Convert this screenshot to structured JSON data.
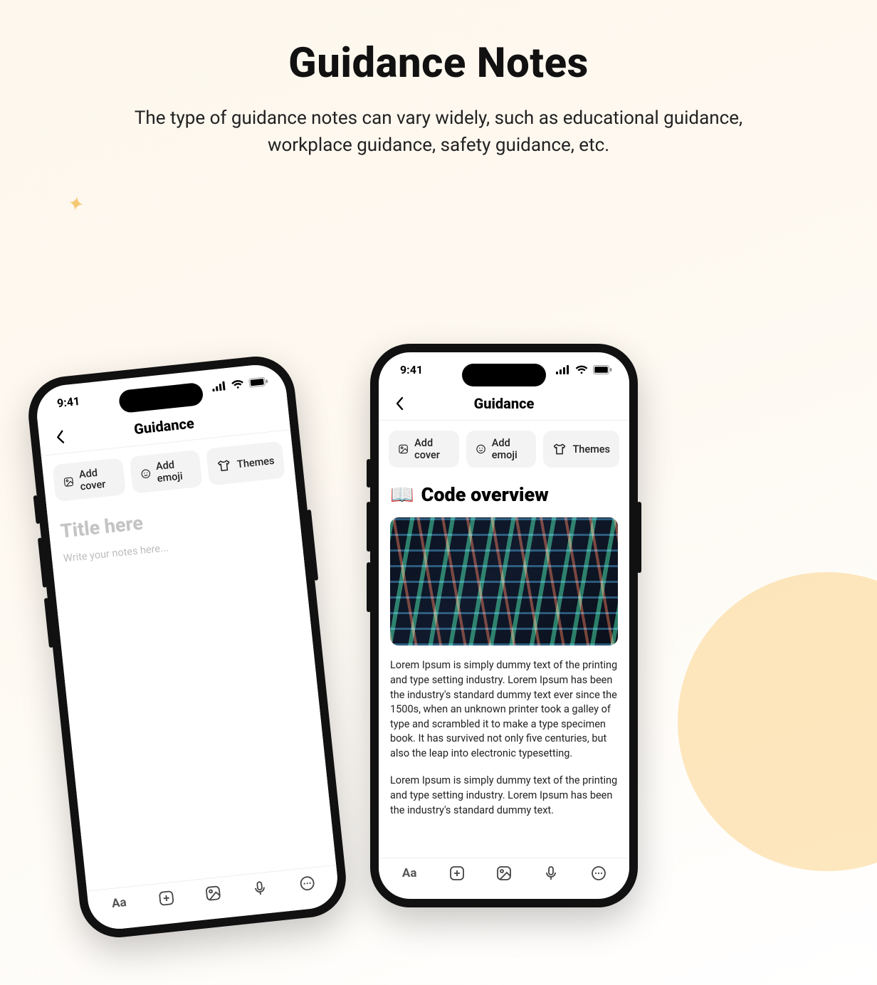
{
  "hero": {
    "title": "Guidance Notes",
    "subtitle": "The type of guidance notes can vary widely, such as educational guidance, workplace guidance, safety guidance, etc."
  },
  "status": {
    "time": "9:41"
  },
  "header": {
    "title": "Guidance"
  },
  "chips": {
    "add_cover": "Add cover",
    "add_emoji": "Add emoji",
    "themes": "Themes"
  },
  "empty": {
    "title_placeholder": "Title here",
    "body_placeholder": "Write your notes here..."
  },
  "note": {
    "emoji": "📖",
    "title": "Code overview",
    "p1": "Lorem Ipsum is simply dummy text of the printing and type setting industry. Lorem Ipsum has been the industry's standard dummy text ever since the 1500s, when an unknown printer took a galley of type and scrambled it to make a type specimen book. It has survived not only five centuries, but also the leap into electronic typesetting.",
    "p2": "Lorem Ipsum is simply dummy text of the printing and type setting industry. Lorem Ipsum has been the industry's standard dummy text."
  },
  "toolbar": {
    "text_label": "Aa"
  }
}
